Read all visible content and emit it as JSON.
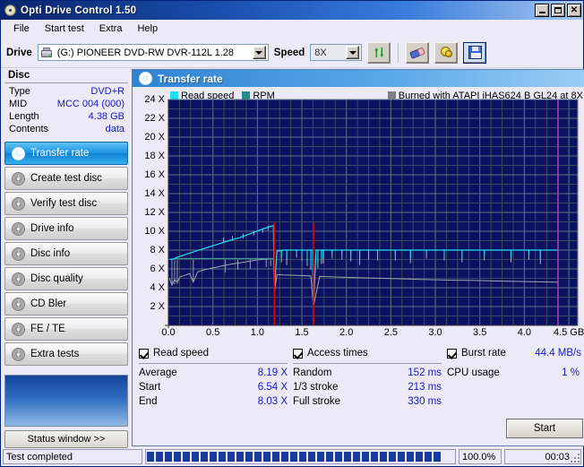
{
  "window": {
    "title": "Opti Drive Control 1.50",
    "icon": "disc-icon",
    "minimize": "_",
    "maximize": "□",
    "close": "✕"
  },
  "menu": [
    "File",
    "Start test",
    "Extra",
    "Help"
  ],
  "toolbar": {
    "drive_label": "Drive",
    "drive_value": "(G:)  PIONEER DVD-RW  DVR-112L 1.28",
    "speed_label": "Speed",
    "speed_value": "8X",
    "buttons": [
      {
        "name": "refresh-button",
        "icon": "refresh-icon"
      },
      {
        "name": "erase-button",
        "icon": "eraser-icon"
      },
      {
        "name": "bookmark-button",
        "icon": "gold-coins-icon"
      },
      {
        "name": "save-button",
        "icon": "floppy-save-icon"
      }
    ]
  },
  "disc": {
    "heading": "Disc",
    "rows": [
      {
        "key": "Type",
        "value": "DVD+R"
      },
      {
        "key": "MID",
        "value": "MCC 004 (000)"
      },
      {
        "key": "Length",
        "value": "4.38 GB"
      },
      {
        "key": "Contents",
        "value": "data"
      }
    ]
  },
  "nav": {
    "items": [
      {
        "label": "Transfer rate",
        "active": true
      },
      {
        "label": "Create test disc",
        "active": false
      },
      {
        "label": "Verify test disc",
        "active": false
      },
      {
        "label": "Drive info",
        "active": false
      },
      {
        "label": "Disc info",
        "active": false
      },
      {
        "label": "Disc quality",
        "active": false
      },
      {
        "label": "CD Bler",
        "active": false
      },
      {
        "label": "FE / TE",
        "active": false
      },
      {
        "label": "Extra tests",
        "active": false
      }
    ],
    "status_button": "Status window >>"
  },
  "panel": {
    "title": "Transfer rate"
  },
  "stats": {
    "read_speed": {
      "check_label": "Read speed",
      "checked": true,
      "rows": [
        {
          "key": "Average",
          "value": "8.19 X"
        },
        {
          "key": "Start",
          "value": "6.54 X"
        },
        {
          "key": "End",
          "value": "8.03 X"
        }
      ]
    },
    "access_times": {
      "check_label": "Access times",
      "checked": true,
      "rows": [
        {
          "key": "Random",
          "value": "152 ms"
        },
        {
          "key": "1/3 stroke",
          "value": "213 ms"
        },
        {
          "key": "Full stroke",
          "value": "330 ms"
        }
      ]
    },
    "burst": {
      "check_label": "Burst rate",
      "checked": true,
      "value": "44.4 MB/s",
      "rows": [
        {
          "key": "CPU usage",
          "value": "1 %"
        }
      ]
    },
    "start_button": "Start"
  },
  "statusbar": {
    "message": "Test completed",
    "percent": "100.0%",
    "elapsed": "00:03",
    "progress_value": 100
  },
  "colors": {
    "read_speed": "#20e0f0",
    "rpm": "#2a8a8a",
    "burn_note": "#808080",
    "plot_bg": "#0b1060",
    "grid": "#4a5a6a",
    "marker_red": "#e00000",
    "marker_magenta": "#c030c0",
    "value_blue": "#1818c8",
    "accent": "#1e94e0"
  },
  "chart_data": {
    "type": "line",
    "title": "Transfer rate",
    "xlabel": "GB",
    "ylabel": "X",
    "xlim": [
      0.0,
      4.6
    ],
    "ylim": [
      0,
      24
    ],
    "xticks": [
      0.0,
      0.5,
      1.0,
      1.5,
      2.0,
      2.5,
      3.0,
      3.5,
      4.0,
      4.5
    ],
    "xtick_labels": [
      "0.0",
      "0.5",
      "1.0",
      "1.5",
      "2.0",
      "2.5",
      "3.0",
      "3.5",
      "4.0",
      "4.5 GB"
    ],
    "yticks": [
      2,
      4,
      6,
      8,
      10,
      12,
      14,
      16,
      18,
      20,
      22,
      24
    ],
    "ytick_labels": [
      "2 X",
      "4 X",
      "6 X",
      "8 X",
      "10 X",
      "12 X",
      "14 X",
      "16 X",
      "18 X",
      "20 X",
      "22 X",
      "24 X"
    ],
    "grid": true,
    "legend": [
      {
        "label": "Read speed",
        "color": "#20e0f0"
      },
      {
        "label": "RPM",
        "color": "#2a8a8a"
      },
      {
        "label": "Burned with ATAPI iHAS624   B GL24 at 8X",
        "color": "#808080"
      }
    ],
    "markers": [
      {
        "x": 1.19,
        "color": "#e00000",
        "type": "layer-break-red"
      },
      {
        "x": 1.63,
        "color": "#e00000",
        "type": "layer-break-red"
      },
      {
        "x": 4.38,
        "color": "#c030c0",
        "type": "disc-end-magenta"
      }
    ],
    "series": [
      {
        "name": "Read speed",
        "color": "#20e0f0",
        "points": [
          [
            0.01,
            7.0
          ],
          [
            0.05,
            7.05
          ],
          [
            0.1,
            7.25
          ],
          [
            0.18,
            7.5
          ],
          [
            0.28,
            7.8
          ],
          [
            0.38,
            8.1
          ],
          [
            0.48,
            8.4
          ],
          [
            0.58,
            8.7
          ],
          [
            0.68,
            9.0
          ],
          [
            0.75,
            9.2
          ],
          [
            0.8,
            9.3
          ],
          [
            0.88,
            9.6
          ],
          [
            0.95,
            9.85
          ],
          [
            1.02,
            10.1
          ],
          [
            1.08,
            10.3
          ],
          [
            1.14,
            10.5
          ],
          [
            1.18,
            10.6
          ],
          [
            1.19,
            3.6
          ],
          [
            1.22,
            7.9
          ],
          [
            1.3,
            8.0
          ],
          [
            1.5,
            8.0
          ],
          [
            1.62,
            8.0
          ],
          [
            1.63,
            2.0
          ],
          [
            1.66,
            8.0
          ],
          [
            1.8,
            8.0
          ],
          [
            2.0,
            8.0
          ],
          [
            2.2,
            8.0
          ],
          [
            2.4,
            8.0
          ],
          [
            2.6,
            8.0
          ],
          [
            2.8,
            8.0
          ],
          [
            3.0,
            8.0
          ],
          [
            3.2,
            8.0
          ],
          [
            3.4,
            8.0
          ],
          [
            3.6,
            8.0
          ],
          [
            3.8,
            8.0
          ],
          [
            4.0,
            8.0
          ],
          [
            4.2,
            8.0
          ],
          [
            4.38,
            8.0
          ]
        ],
        "dropouts": [
          [
            1.27,
            6.7
          ],
          [
            1.33,
            6.4
          ],
          [
            1.44,
            7.2
          ],
          [
            1.5,
            6.9
          ],
          [
            1.56,
            6.3
          ],
          [
            1.6,
            5.9
          ],
          [
            1.68,
            6.1
          ],
          [
            1.72,
            6.5
          ],
          [
            1.74,
            6.6
          ],
          [
            1.84,
            7.1
          ],
          [
            1.95,
            7.0
          ],
          [
            2.05,
            6.8
          ],
          [
            2.15,
            6.4
          ],
          [
            2.25,
            7.0
          ],
          [
            2.35,
            6.9
          ],
          [
            2.55,
            6.9
          ],
          [
            2.72,
            6.6
          ],
          [
            2.9,
            7.1
          ],
          [
            3.1,
            6.9
          ],
          [
            3.3,
            6.7
          ],
          [
            3.55,
            6.9
          ],
          [
            3.85,
            6.7
          ],
          [
            4.05,
            7.0
          ],
          [
            4.18,
            6.5
          ]
        ]
      },
      {
        "name": "RPM",
        "color": "#2a8a8a",
        "points": [
          [
            0.01,
            5.0
          ],
          [
            0.04,
            4.3
          ],
          [
            0.07,
            4.9
          ],
          [
            0.1,
            4.55
          ],
          [
            0.13,
            5.15
          ],
          [
            0.18,
            5.3
          ],
          [
            0.24,
            5.5
          ],
          [
            0.28,
            4.6
          ],
          [
            0.33,
            5.7
          ],
          [
            0.4,
            5.9
          ],
          [
            0.5,
            6.1
          ],
          [
            0.6,
            6.3
          ],
          [
            0.7,
            6.5
          ],
          [
            0.8,
            6.65
          ],
          [
            0.9,
            6.8
          ],
          [
            1.0,
            6.95
          ],
          [
            1.1,
            7.05
          ],
          [
            1.18,
            7.1
          ],
          [
            1.19,
            3.4
          ],
          [
            1.22,
            5.4
          ],
          [
            1.3,
            5.35
          ],
          [
            1.45,
            5.3
          ],
          [
            1.6,
            5.25
          ],
          [
            1.63,
            2.0
          ],
          [
            1.7,
            5.2
          ],
          [
            1.85,
            5.15
          ],
          [
            2.0,
            5.1
          ],
          [
            2.2,
            5.05
          ],
          [
            2.4,
            5.0
          ],
          [
            2.6,
            4.95
          ],
          [
            2.8,
            4.9
          ],
          [
            3.0,
            4.85
          ],
          [
            3.2,
            4.8
          ],
          [
            3.4,
            4.78
          ],
          [
            3.6,
            4.74
          ],
          [
            3.8,
            4.7
          ],
          [
            4.0,
            4.66
          ],
          [
            4.2,
            4.62
          ],
          [
            4.38,
            4.6
          ]
        ],
        "plateau": {
          "from": 0.07,
          "to": 1.18,
          "value": 7.1,
          "note": "flat upper RPM segment"
        }
      }
    ]
  }
}
